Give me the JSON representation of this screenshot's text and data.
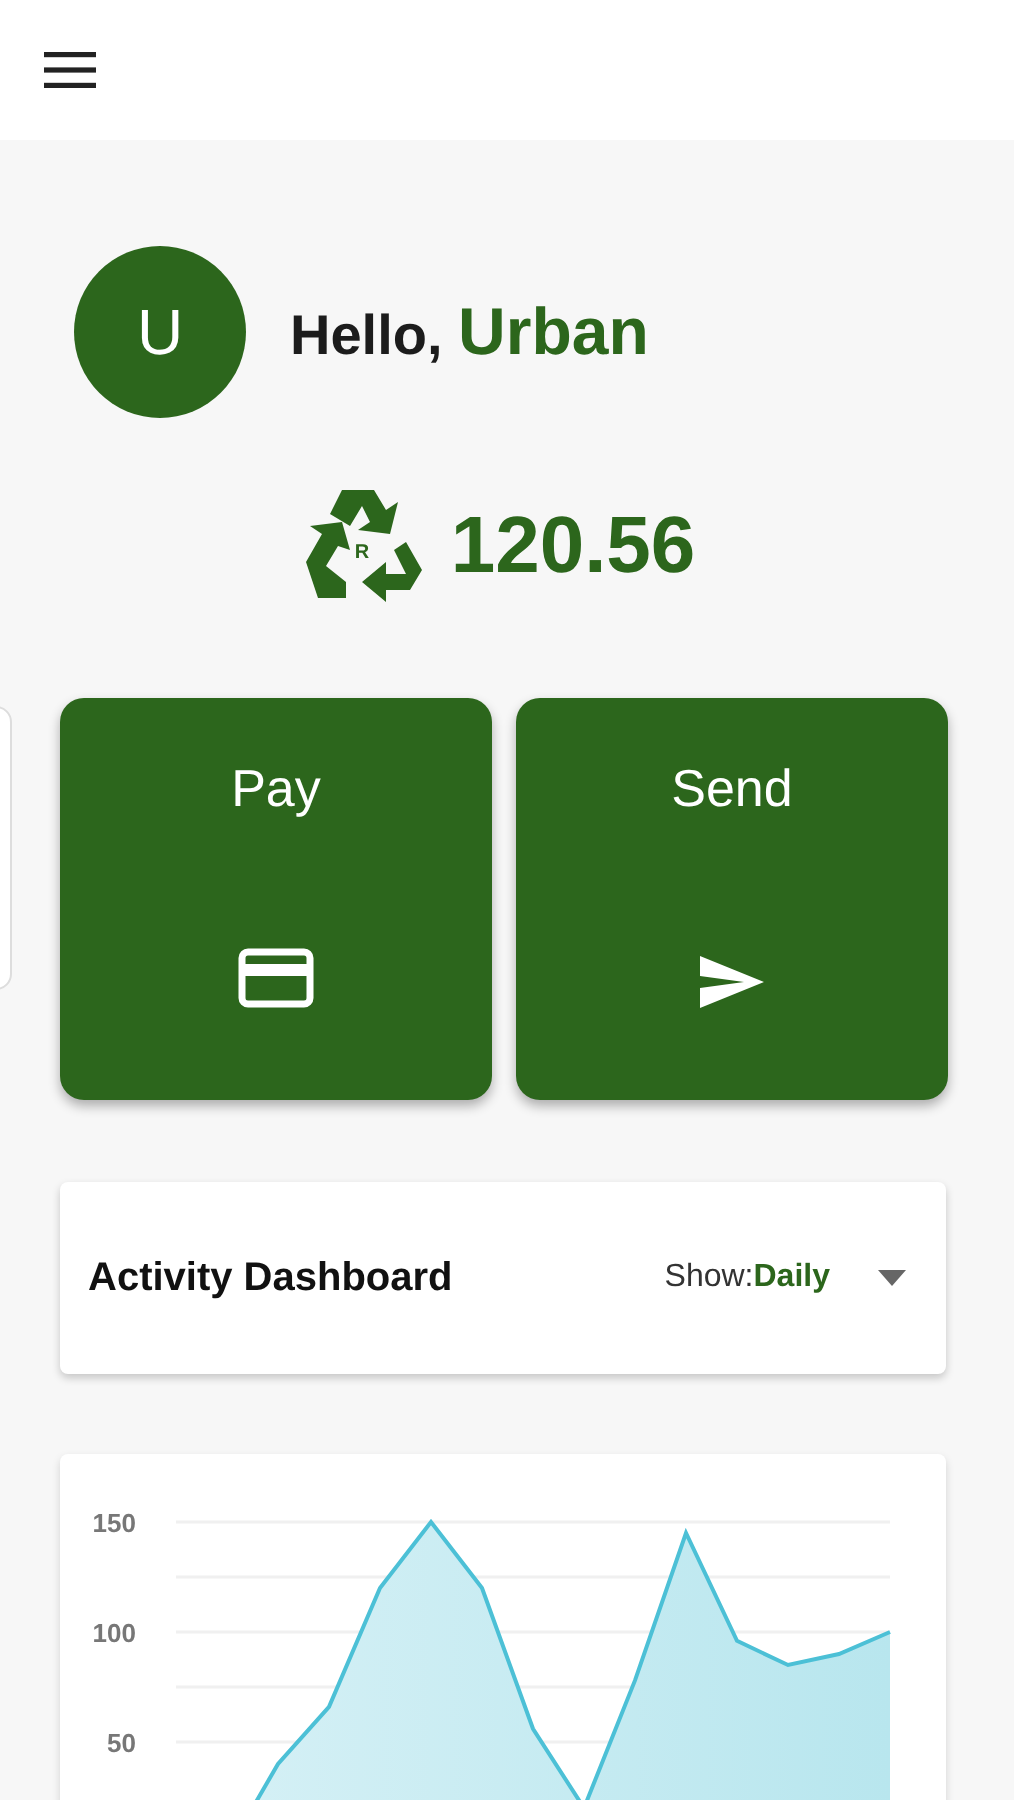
{
  "user": {
    "initial": "U",
    "greeting": "Hello,",
    "name": "Urban"
  },
  "balance": {
    "amount": "120.56",
    "icon_letter": "R"
  },
  "actions": [
    {
      "label": "Pay",
      "kind": "card"
    },
    {
      "label": "Send",
      "kind": "send"
    }
  ],
  "dashboard": {
    "title": "Activity Dashboard",
    "filter_label": "Show:",
    "filter_value": "Daily"
  },
  "chart": {
    "chart_data": {
      "type": "area",
      "categories": [
        null,
        null,
        null,
        null,
        null,
        null,
        null,
        null,
        null,
        null,
        null,
        null,
        null,
        null,
        null
      ],
      "ylim": [
        0,
        150
      ],
      "yticks": [
        50,
        100,
        150
      ],
      "series": [
        {
          "color": "#4cc0d6",
          "values": [
            0,
            0,
            40,
            66,
            120,
            150,
            120,
            56,
            20,
            78,
            145,
            96,
            85,
            90,
            100
          ]
        }
      ]
    }
  }
}
